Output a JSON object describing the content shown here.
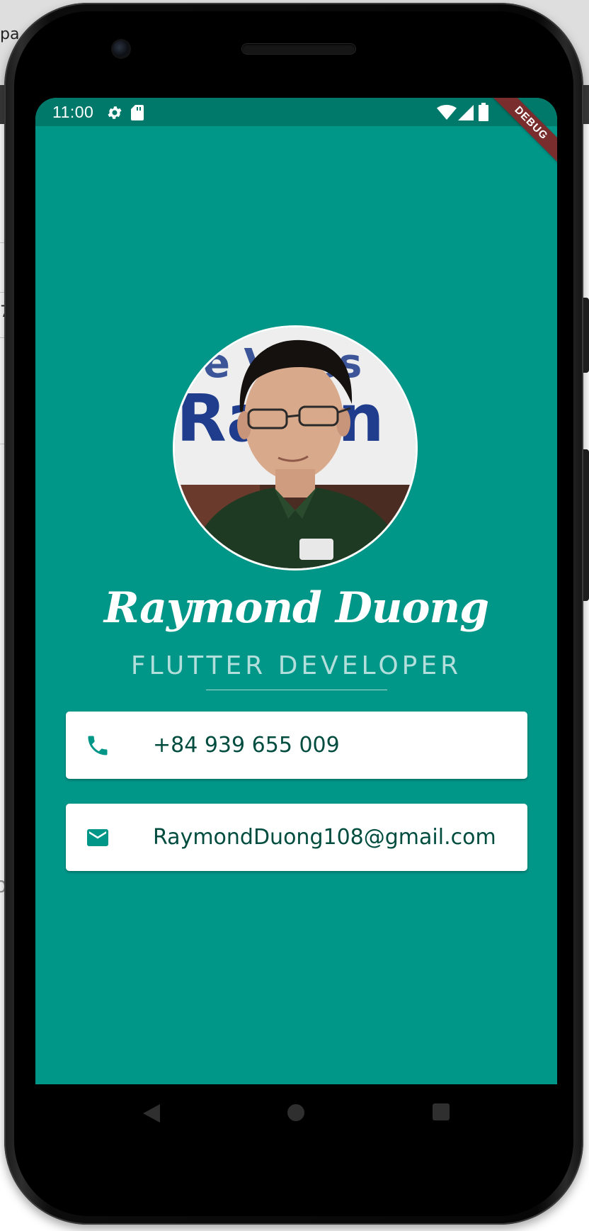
{
  "status_bar": {
    "time": "11:00",
    "icons": [
      "gear-icon",
      "sd-card-icon",
      "wifi-icon",
      "signal-icon",
      "battery-icon"
    ]
  },
  "debug_banner": "DEBUG",
  "profile": {
    "avatar_image": "profile photo of a man wearing glasses and a dark green polo shirt in front of a banner",
    "name": "Raymond Duong",
    "title": "FLUTTER DEVELOPER"
  },
  "contacts": [
    {
      "icon": "phone-icon",
      "text": "+84 939 655 009"
    },
    {
      "icon": "email-icon",
      "text": "RaymondDuong108@gmail.com"
    }
  ],
  "nav_bar": {
    "buttons": [
      "back-icon",
      "home-icon",
      "recents-icon"
    ]
  },
  "background_fragments": [
    "pa",
    "7",
    "o"
  ],
  "colors": {
    "background": "#009688",
    "status_bar": "#00796b",
    "subtitle": "#b2dfdb",
    "card_text": "#004d40",
    "icon": "#009688",
    "card": "#ffffff",
    "debug_banner": "#7a2d2d"
  }
}
